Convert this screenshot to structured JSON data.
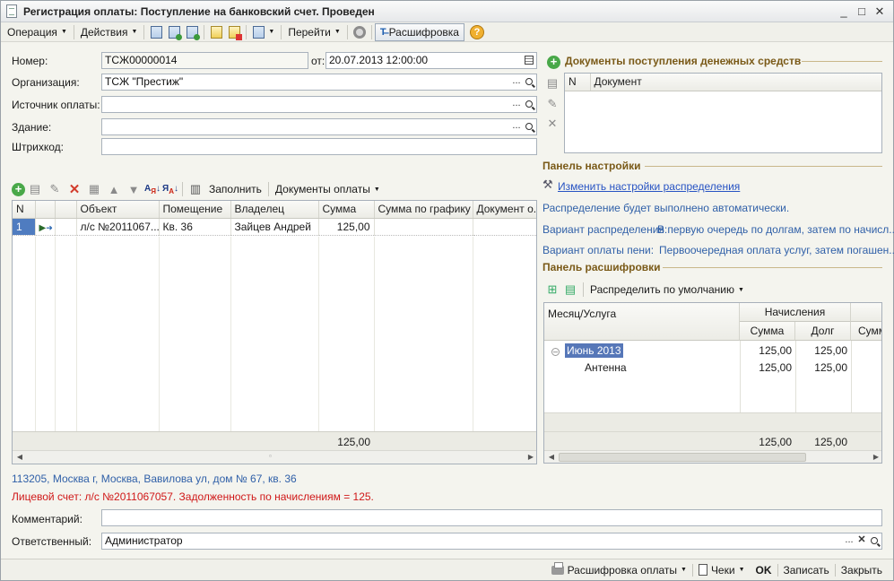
{
  "window": {
    "title": "Регистрация оплаты: Поступление на банковский счет. Проведен",
    "controls": {
      "minimize": "_",
      "maximize": "□",
      "close": "✕"
    }
  },
  "toolbar": {
    "operation": "Операция",
    "actions": "Действия",
    "goto": "Перейти",
    "decode": "Расшифровка",
    "help": "?"
  },
  "form": {
    "number_label": "Номер:",
    "number_value": "ТСЖ00000014",
    "date_label": "от:",
    "date_value": "20.07.2013 12:00:00",
    "org_label": "Организация:",
    "org_value": "ТСЖ \"Престиж\"",
    "source_label": "Источник оплаты:",
    "source_value": "",
    "building_label": "Здание:",
    "building_value": "",
    "barcode_label": "Штрихкод:",
    "barcode_value": ""
  },
  "docs_panel": {
    "title": "Документы поступления денежных средств",
    "columns": [
      "N",
      "Документ"
    ]
  },
  "settings_panel": {
    "title": "Панель настройки",
    "change_link": "Изменить настройки распределения",
    "auto_text": "Распределение будет выполнено автоматически.",
    "variant_label": "Вариант распределения:",
    "variant_value": "В первую очередь по долгам, затем по начисл...",
    "penalty_label": "Вариант оплаты пени:",
    "penalty_value": "Первоочередная оплата услуг, затем погашен..."
  },
  "table_toolbar": {
    "fill": "Заполнить",
    "payment_docs": "Документы оплаты"
  },
  "main_table": {
    "columns": [
      "N",
      "",
      "",
      "Объект",
      "Помещение",
      "Владелец",
      "Сумма",
      "Сумма по графику",
      "Документ о..."
    ],
    "rows": [
      {
        "n": "1",
        "object": "л/с №2011067...",
        "room": "Кв. 36",
        "owner": "Зайцев Андрей",
        "sum": "125,00",
        "sum_schedule": "",
        "doc": ""
      }
    ],
    "total_sum": "125,00"
  },
  "decode_panel": {
    "title": "Панель расшифровки",
    "distribute": "Распределить по умолчанию",
    "col_month": "Месяц/Услуга",
    "col_accruals": "Начисления",
    "col_sum": "Сумма",
    "col_debt": "Долг",
    "col_sum2": "Сумм",
    "rows": [
      {
        "name": "Июнь 2013",
        "sum": "125,00",
        "debt": "125,00"
      },
      {
        "name": "Антенна",
        "sum": "125,00",
        "debt": "125,00"
      }
    ],
    "total_sum": "125,00",
    "total_debt": "125,00"
  },
  "address": "113205, Москва г, Москва, Вавилова ул, дом № 67, кв. 36",
  "account_warning": "Лицевой счет: л/с №2011067057. Задолженность по начислениям = 125.",
  "comment_label": "Комментарий:",
  "comment_value": "",
  "responsible_label": "Ответственный:",
  "responsible_value": "Администратор",
  "bottom": {
    "decode_payment": "Расшифровка оплаты",
    "receipts": "Чеки",
    "ok": "OK",
    "save": "Записать",
    "close": "Закрыть"
  }
}
